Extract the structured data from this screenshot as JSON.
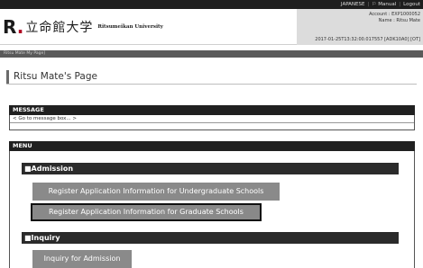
{
  "topbar": {
    "language": "JAPANESE",
    "manual": "Manual",
    "logout": "Logout"
  },
  "header": {
    "logo_mark": "R",
    "logo_jp": "立命館大学",
    "logo_en": "Ritsumeikan University",
    "account_line": "Account : EXP1000052",
    "name_line": "Name : Ritsu Mate",
    "timestamp": "2017-01-25T13:32:00.017557 [ADK10A0] [OT]"
  },
  "breadcrumb": "Ritsu Mate My Page]",
  "page_title": "Ritsu Mate's Page",
  "message": {
    "heading": "MESSAGE",
    "link": "< Go to message box... >"
  },
  "menu": {
    "heading": "MENU",
    "categories": [
      {
        "title": "■Admission",
        "buttons": [
          "Register Application Information for Undergraduate Schools",
          "Register Application Information for Graduate Schools"
        ]
      },
      {
        "title": "■Inquiry",
        "buttons": [
          "Inquiry for Admission"
        ]
      }
    ]
  }
}
